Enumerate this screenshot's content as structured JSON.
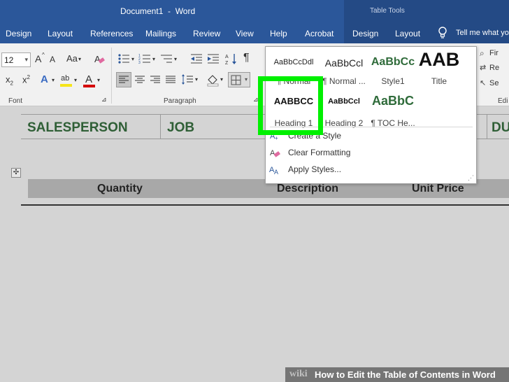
{
  "titlebar": {
    "title": "Document1  -  Word",
    "table_tools": "Table Tools"
  },
  "tabs": [
    "Design",
    "Layout",
    "References",
    "Mailings",
    "Review",
    "View",
    "Help",
    "Acrobat",
    "Design",
    "Layout"
  ],
  "tell_me": "Tell me what yo",
  "ribbon": {
    "font_size": "12",
    "font_group_label": "Font",
    "paragraph_group_label": "Paragraph",
    "editing_group_label": "Edi",
    "right_items": [
      "Fir",
      "Re",
      "Se"
    ],
    "icons": {
      "grow": "A",
      "shrink": "A",
      "change_case": "Aa",
      "x2_sub": "x",
      "x2_sup": "x",
      "text_effects": "A",
      "highlight": "ab",
      "font_color": "A",
      "pilcrow": "¶"
    }
  },
  "styles_gallery": {
    "tiles": [
      {
        "sample": "AaBbCcDdl",
        "name": "¶ Normal"
      },
      {
        "sample": "AaBbCcl",
        "name": "¶ Normal ..."
      },
      {
        "sample": "AaBbCc",
        "name": "Style1"
      },
      {
        "sample": "AAB",
        "name": "Title"
      },
      {
        "sample": "AABBCC",
        "name": "Heading 1"
      },
      {
        "sample": "AaBbCcl",
        "name": "Heading 2"
      },
      {
        "sample": "AaBbC",
        "name": "¶ TOC He..."
      }
    ],
    "menu": [
      "Create a Style",
      "Clear Formatting",
      "Apply Styles..."
    ],
    "highlight_color": "#00f000"
  },
  "document": {
    "header_cells": [
      "SALESPERSON",
      "JOB",
      "DU"
    ],
    "columns": [
      "Quantity",
      "Description",
      "Unit Price"
    ],
    "heading_color": "#2f5f36",
    "move_handle": "✣"
  },
  "watermark": {
    "wiki": "wiki",
    "how": "How to Edit the Table of Contents in Word"
  },
  "colors": {
    "title_blue": "#2b579a",
    "ribbon_bg": "#f1f1f1"
  }
}
